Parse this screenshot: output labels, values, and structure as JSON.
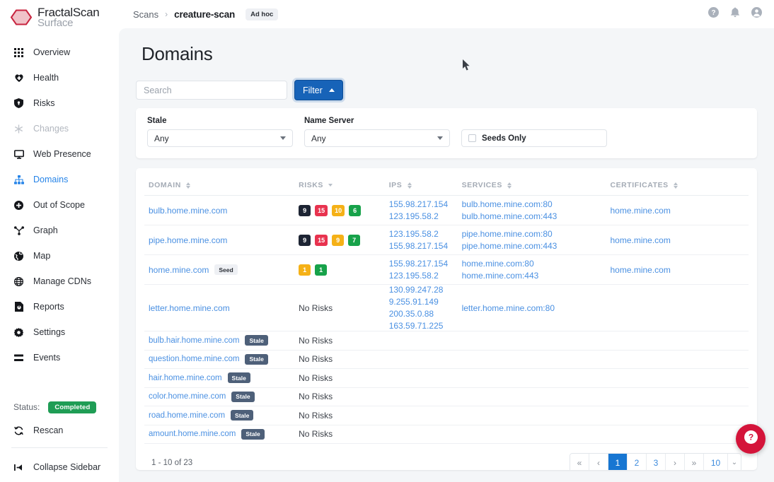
{
  "brand": {
    "line1": "FractalScan",
    "line2": "Surface",
    "logo_icon": "hexagon-logo-icon",
    "logo_color": "#cc2244"
  },
  "sidebar": {
    "items": [
      {
        "label": "Overview",
        "icon": "grid-icon",
        "state": "normal"
      },
      {
        "label": "Health",
        "icon": "heart-pulse-icon",
        "state": "normal"
      },
      {
        "label": "Risks",
        "icon": "shield-icon",
        "state": "normal"
      },
      {
        "label": "Changes",
        "icon": "asterisk-icon",
        "state": "disabled"
      },
      {
        "label": "Web Presence",
        "icon": "monitor-icon",
        "state": "normal"
      },
      {
        "label": "Domains",
        "icon": "sitemap-icon",
        "state": "active"
      },
      {
        "label": "Out of Scope",
        "icon": "plus-circle-icon",
        "state": "normal"
      },
      {
        "label": "Graph",
        "icon": "graph-node-icon",
        "state": "normal"
      },
      {
        "label": "Map",
        "icon": "globe-icon",
        "state": "normal"
      },
      {
        "label": "Manage CDNs",
        "icon": "globe-grid-icon",
        "state": "normal"
      },
      {
        "label": "Reports",
        "icon": "report-icon",
        "state": "normal"
      },
      {
        "label": "Settings",
        "icon": "gear-icon",
        "state": "normal"
      },
      {
        "label": "Events",
        "icon": "list-icon",
        "state": "normal"
      }
    ],
    "status_label": "Status:",
    "status_value": "Completed",
    "status_color": "#1f9d55",
    "rescan_label": "Rescan",
    "rescan_icon": "refresh-icon",
    "collapse_label": "Collapse Sidebar",
    "collapse_icon": "collapse-left-icon"
  },
  "topbar": {
    "crumb_root": "Scans",
    "crumb_sep": "›",
    "crumb_current": "creature-scan",
    "scan_type_badge": "Ad hoc",
    "icons": [
      {
        "name": "help-circle-icon",
        "glyph": "?"
      },
      {
        "name": "bell-icon",
        "glyph": "🔔"
      },
      {
        "name": "account-icon",
        "glyph": "👤"
      }
    ]
  },
  "page": {
    "title": "Domains"
  },
  "controls": {
    "search_placeholder": "Search",
    "search_value": "",
    "filter_label": "Filter",
    "filter_expanded": true
  },
  "filters": {
    "stale": {
      "label": "Stale",
      "value": "Any"
    },
    "name_server": {
      "label": "Name Server",
      "value": "Any"
    },
    "seeds_only": {
      "label": "Seeds Only",
      "checked": false
    }
  },
  "table": {
    "columns": [
      {
        "key": "domain",
        "label": "DOMAIN",
        "sort": "both"
      },
      {
        "key": "risks",
        "label": "RISKS",
        "sort": "desc"
      },
      {
        "key": "ips",
        "label": "IPS",
        "sort": "both"
      },
      {
        "key": "services",
        "label": "SERVICES",
        "sort": "both"
      },
      {
        "key": "certificates",
        "label": "CERTIFICATES",
        "sort": "both"
      }
    ],
    "no_risks_label": "No Risks",
    "rows": [
      {
        "domain": "bulb.home.mine.com",
        "tag": null,
        "risks": [
          {
            "value": "9",
            "color": "#1d2433"
          },
          {
            "value": "15",
            "color": "#e8334f"
          },
          {
            "value": "10",
            "color": "#f5b117"
          },
          {
            "value": "6",
            "color": "#17a24a"
          }
        ],
        "ips": [
          "155.98.217.154",
          "123.195.58.2"
        ],
        "services": [
          "bulb.home.mine.com:80",
          "bulb.home.mine.com:443"
        ],
        "certificates": [
          "home.mine.com"
        ]
      },
      {
        "domain": "pipe.home.mine.com",
        "tag": null,
        "risks": [
          {
            "value": "9",
            "color": "#1d2433"
          },
          {
            "value": "15",
            "color": "#e8334f"
          },
          {
            "value": "9",
            "color": "#f5b117"
          },
          {
            "value": "7",
            "color": "#17a24a"
          }
        ],
        "ips": [
          "123.195.58.2",
          "155.98.217.154"
        ],
        "services": [
          "pipe.home.mine.com:80",
          "pipe.home.mine.com:443"
        ],
        "certificates": [
          "home.mine.com"
        ]
      },
      {
        "domain": "home.mine.com",
        "tag": "Seed",
        "risks": [
          {
            "value": "1",
            "color": "#f5b117"
          },
          {
            "value": "1",
            "color": "#17a24a"
          }
        ],
        "ips": [
          "155.98.217.154",
          "123.195.58.2"
        ],
        "services": [
          "home.mine.com:80",
          "home.mine.com:443"
        ],
        "certificates": [
          "home.mine.com"
        ]
      },
      {
        "domain": "letter.home.mine.com",
        "tag": null,
        "risks": [],
        "ips": [
          "130.99.247.28",
          "9.255.91.149",
          "200.35.0.88",
          "163.59.71.225"
        ],
        "services": [
          "letter.home.mine.com:80"
        ],
        "certificates": []
      },
      {
        "domain": "bulb.hair.home.mine.com",
        "tag": "Stale",
        "risks": [],
        "ips": [],
        "services": [],
        "certificates": []
      },
      {
        "domain": "question.home.mine.com",
        "tag": "Stale",
        "risks": [],
        "ips": [],
        "services": [],
        "certificates": []
      },
      {
        "domain": "hair.home.mine.com",
        "tag": "Stale",
        "risks": [],
        "ips": [],
        "services": [],
        "certificates": []
      },
      {
        "domain": "color.home.mine.com",
        "tag": "Stale",
        "risks": [],
        "ips": [],
        "services": [],
        "certificates": []
      },
      {
        "domain": "road.home.mine.com",
        "tag": "Stale",
        "risks": [],
        "ips": [],
        "services": [],
        "certificates": []
      },
      {
        "domain": "amount.home.mine.com",
        "tag": "Stale",
        "risks": [],
        "ips": [],
        "services": [],
        "certificates": []
      }
    ]
  },
  "pagination": {
    "count_text": "1 - 10 of 23",
    "first": "«",
    "prev": "‹",
    "pages": [
      "1",
      "2",
      "3"
    ],
    "active_page": "1",
    "next": "›",
    "last": "»",
    "page_size": "10",
    "page_size_chev": "⌄"
  },
  "fab": {
    "icon": "help-question-icon",
    "glyph": "?",
    "color": "#d4143a"
  }
}
